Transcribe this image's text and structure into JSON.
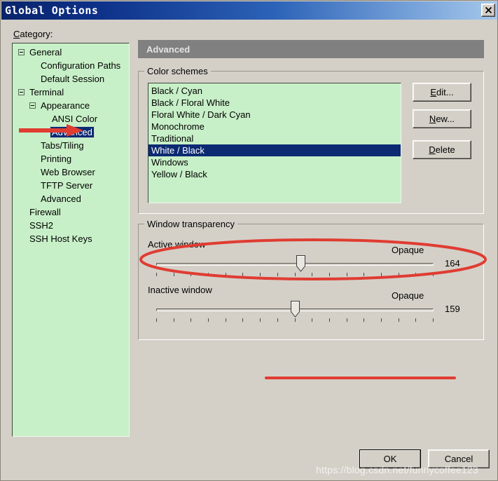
{
  "window": {
    "title": "Global Options",
    "close_icon": "close-x-icon"
  },
  "category": {
    "label_prefix": "C",
    "label_rest": "ategory:"
  },
  "tree": {
    "items": [
      {
        "label": "General",
        "depth": 0,
        "expander": true,
        "selected": false
      },
      {
        "label": "Configuration Paths",
        "depth": 1,
        "expander": false,
        "selected": false
      },
      {
        "label": "Default Session",
        "depth": 1,
        "expander": false,
        "selected": false
      },
      {
        "label": "Terminal",
        "depth": 0,
        "expander": true,
        "selected": false
      },
      {
        "label": "Appearance",
        "depth": 1,
        "expander": true,
        "selected": false
      },
      {
        "label": "ANSI Color",
        "depth": 2,
        "expander": false,
        "selected": false
      },
      {
        "label": "Advanced",
        "depth": 2,
        "expander": false,
        "selected": true
      },
      {
        "label": "Tabs/Tiling",
        "depth": 1,
        "expander": false,
        "selected": false
      },
      {
        "label": "Printing",
        "depth": 1,
        "expander": false,
        "selected": false
      },
      {
        "label": "Web Browser",
        "depth": 1,
        "expander": false,
        "selected": false
      },
      {
        "label": "TFTP Server",
        "depth": 1,
        "expander": false,
        "selected": false
      },
      {
        "label": "Advanced",
        "depth": 1,
        "expander": false,
        "selected": false
      },
      {
        "label": "Firewall",
        "depth": 0,
        "expander": false,
        "selected": false
      },
      {
        "label": "SSH2",
        "depth": 0,
        "expander": false,
        "selected": false
      },
      {
        "label": "SSH Host Keys",
        "depth": 0,
        "expander": false,
        "selected": false
      }
    ]
  },
  "content": {
    "header_title": "Advanced"
  },
  "color_schemes": {
    "group_title": "Color schemes",
    "items": [
      "Black / Cyan",
      "Black / Floral White",
      "Floral White / Dark Cyan",
      "Monochrome",
      "Traditional",
      "White / Black",
      "Windows",
      "Yellow / Black"
    ],
    "selected": "White / Black",
    "buttons": {
      "edit": {
        "mnemonic": "E",
        "rest": "dit..."
      },
      "new": {
        "mnemonic": "N",
        "rest": "ew..."
      },
      "delete": {
        "mnemonic": "D",
        "rest": "elete"
      }
    }
  },
  "transparency": {
    "group_title": "Window transparency",
    "sliders": [
      {
        "caption": "Active window",
        "end_label": "Opaque",
        "value": "164",
        "percent": 52,
        "ticks": 17
      },
      {
        "caption": "Inactive window",
        "end_label": "Opaque",
        "value": "159",
        "percent": 50,
        "ticks": 17
      }
    ]
  },
  "footer": {
    "ok": "OK",
    "cancel": "Cancel"
  },
  "watermark": {
    "text": "https://blog.csdn.net/funnycoffee123"
  },
  "annotation_colors": {
    "red": "#e03c32"
  }
}
